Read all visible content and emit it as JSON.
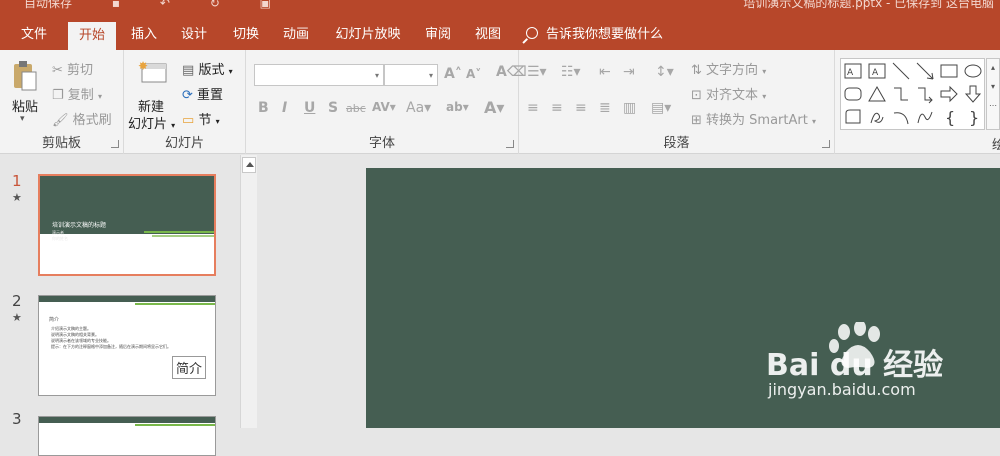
{
  "title_bar": {
    "quick_access": [
      "自动保存"
    ],
    "document": "培训演示文稿的标题.pptx - 已保存到 这台电脑"
  },
  "tabs": [
    {
      "label": "文件"
    },
    {
      "label": "开始",
      "active": true
    },
    {
      "label": "插入"
    },
    {
      "label": "设计"
    },
    {
      "label": "切换"
    },
    {
      "label": "动画"
    },
    {
      "label": "幻灯片放映"
    },
    {
      "label": "审阅"
    },
    {
      "label": "视图"
    }
  ],
  "tell_me": "告诉我你想要做什么",
  "ribbon": {
    "clipboard": {
      "paste": "粘贴",
      "cut": "剪切",
      "copy": "复制",
      "format_painter": "格式刷",
      "group": "剪贴板"
    },
    "slides": {
      "new_slide_line1": "新建",
      "new_slide_line2": "幻灯片",
      "layout": "版式",
      "reset": "重置",
      "section": "节",
      "group": "幻灯片"
    },
    "font": {
      "font_name": "",
      "font_size": "",
      "group": "字体"
    },
    "paragraph": {
      "text_direction": "文字方向",
      "align_text": "对齐文本",
      "convert_smartart": "转换为 SmartArt",
      "group": "段落"
    },
    "drawing": {
      "group_partial": "绘"
    }
  },
  "slide_thumbnails": [
    {
      "number": "1",
      "title": "培训演示文稿的标题",
      "subtitle_lines": [
        "演示者",
        "你的姓名"
      ]
    },
    {
      "number": "2",
      "heading": "简介",
      "bullets": [
        "介绍演示文稿的主题。",
        "说明演示文稿的相关背景。",
        "说明演示者在该领域的专业技能。",
        "提示：在下方的注释窗格中添加备注，随后在演示期间将显示它们。"
      ]
    },
    {
      "number": "3"
    }
  ],
  "tooltip": "简介",
  "watermark": {
    "logo": "Bai du 经验",
    "url": "jingyan.baidu.com"
  },
  "colors": {
    "ribbon_accent": "#b7472a",
    "slide_background": "#455e52",
    "accent_green": "#79b84a",
    "selected_thumb_border": "#e67e5e"
  }
}
